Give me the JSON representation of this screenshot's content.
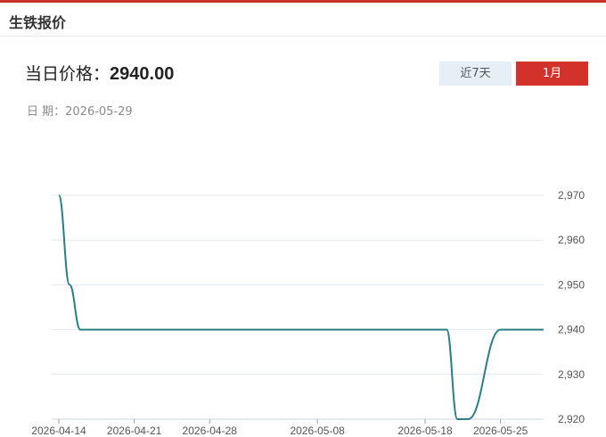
{
  "panel": {
    "title": "生铁报价"
  },
  "price": {
    "label": "当日价格：",
    "value": "2940.00"
  },
  "date": {
    "label": "日 期：",
    "value": "2026-05-29"
  },
  "range_buttons": [
    {
      "label": "近7天",
      "active": false
    },
    {
      "label": "1月",
      "active": true
    }
  ],
  "colors": {
    "accent": "#d3322a",
    "line": "#2a7f82",
    "grid": "#e3e7ef",
    "inactive_button": "#e6eef6"
  },
  "chart_data": {
    "type": "line",
    "title": "",
    "xlabel": "",
    "ylabel": "",
    "ylim": [
      2920,
      2970
    ],
    "yticks": [
      2920,
      2930,
      2940,
      2950,
      2960,
      2970
    ],
    "ytick_labels": [
      "2,920",
      "2,930",
      "2,940",
      "2,950",
      "2,960",
      "2,970"
    ],
    "xtick_labels": [
      "2026-04-14",
      "2026-04-21",
      "2026-04-28",
      "2026-05-08",
      "2026-05-18",
      "2026-05-25"
    ],
    "grid": true,
    "y_axis_position": "right",
    "x": [
      "2026-04-14",
      "2026-04-15",
      "2026-04-16",
      "2026-04-17",
      "2026-04-20",
      "2026-04-21",
      "2026-04-22",
      "2026-04-23",
      "2026-04-24",
      "2026-04-27",
      "2026-04-28",
      "2026-04-29",
      "2026-04-30",
      "2026-05-06",
      "2026-05-07",
      "2026-05-08",
      "2026-05-11",
      "2026-05-12",
      "2026-05-13",
      "2026-05-14",
      "2026-05-15",
      "2026-05-18",
      "2026-05-19",
      "2026-05-20",
      "2026-05-21",
      "2026-05-22",
      "2026-05-25",
      "2026-05-26",
      "2026-05-27",
      "2026-05-28",
      "2026-05-29"
    ],
    "series": [
      {
        "values": [
          2970,
          2950,
          2940,
          2940,
          2940,
          2940,
          2940,
          2940,
          2940,
          2940,
          2940,
          2940,
          2940,
          2940,
          2940,
          2940,
          2940,
          2940,
          2940,
          2940,
          2940,
          2940,
          2940,
          2940,
          2920,
          2920,
          2940,
          2940,
          2940,
          2940,
          2940
        ]
      }
    ]
  }
}
